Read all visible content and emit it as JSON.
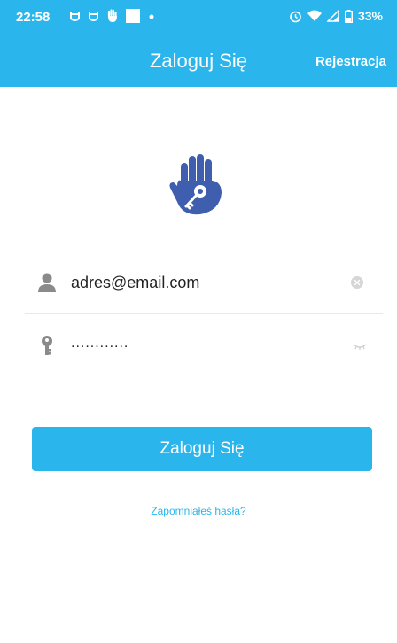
{
  "status_bar": {
    "time": "22:58",
    "battery": "33%",
    "left_icons": [
      "notification-icon",
      "notification-icon",
      "hand-icon",
      "square-icon",
      "dot-icon"
    ],
    "right_icons": [
      "alarm-icon",
      "wifi-icon",
      "signal-icon",
      "battery-icon"
    ]
  },
  "header": {
    "title": "Zaloguj Się",
    "register_label": "Rejestracja",
    "background": "#2ab6ec"
  },
  "logo": {
    "icon": "hand-key-icon",
    "color": "#3f5fae"
  },
  "form": {
    "email": {
      "icon": "person-icon",
      "value": "adres@email.com",
      "placeholder": ""
    },
    "password": {
      "icon": "key-icon",
      "value": "............",
      "placeholder": ""
    }
  },
  "login_button": {
    "label": "Zaloguj Się"
  },
  "forgot_link": {
    "label": "Zapomniałeś hasła?"
  }
}
